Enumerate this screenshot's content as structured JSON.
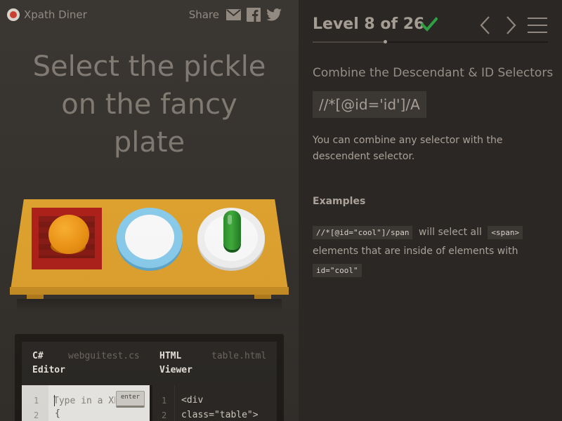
{
  "brand": {
    "name": "Xpath Diner"
  },
  "share": {
    "label": "Share",
    "icons": [
      "mail-icon",
      "facebook-icon",
      "twitter-icon"
    ]
  },
  "instruction": {
    "line1": "Select the pickle",
    "line2": "on the fancy",
    "line3": "plate"
  },
  "table": {
    "items": [
      "bento",
      "orange",
      "plate",
      "plate",
      "pickle"
    ]
  },
  "editor": {
    "left_title_1": "C#",
    "left_title_2": "Editor",
    "left_file": "webguitest.cs",
    "right_title_1": "HTML",
    "right_title_2": "Viewer",
    "right_file": "table.html",
    "input_placeholder": "Type in a XPath selector",
    "enter_label": "enter",
    "left_lines": [
      "1",
      "2"
    ],
    "left_code_line2": "{",
    "right_lines": [
      "1",
      "2"
    ],
    "html_line1": "<div",
    "html_line2": "class=\"table\">"
  },
  "level": {
    "title": "Level 8 of 26",
    "completed": true,
    "current": 8,
    "total": 26
  },
  "lesson": {
    "title": "Combine the Descendant & ID Selectors",
    "syntax": "//*[@id='id']/A",
    "description": "You can combine any selector with the descendent selector.",
    "examples_heading": "Examples",
    "example_code": "//*[@id=\"cool\"]/span",
    "example_text_1": "will select all",
    "example_tag": "<span>",
    "example_text_2": "elements that are inside of elements with",
    "example_attr": "id=\"cool\""
  },
  "colors": {
    "accent": "#2ea043",
    "panel_left": "#34302c",
    "panel_right": "#2b2724",
    "table": "#e2a42d"
  }
}
